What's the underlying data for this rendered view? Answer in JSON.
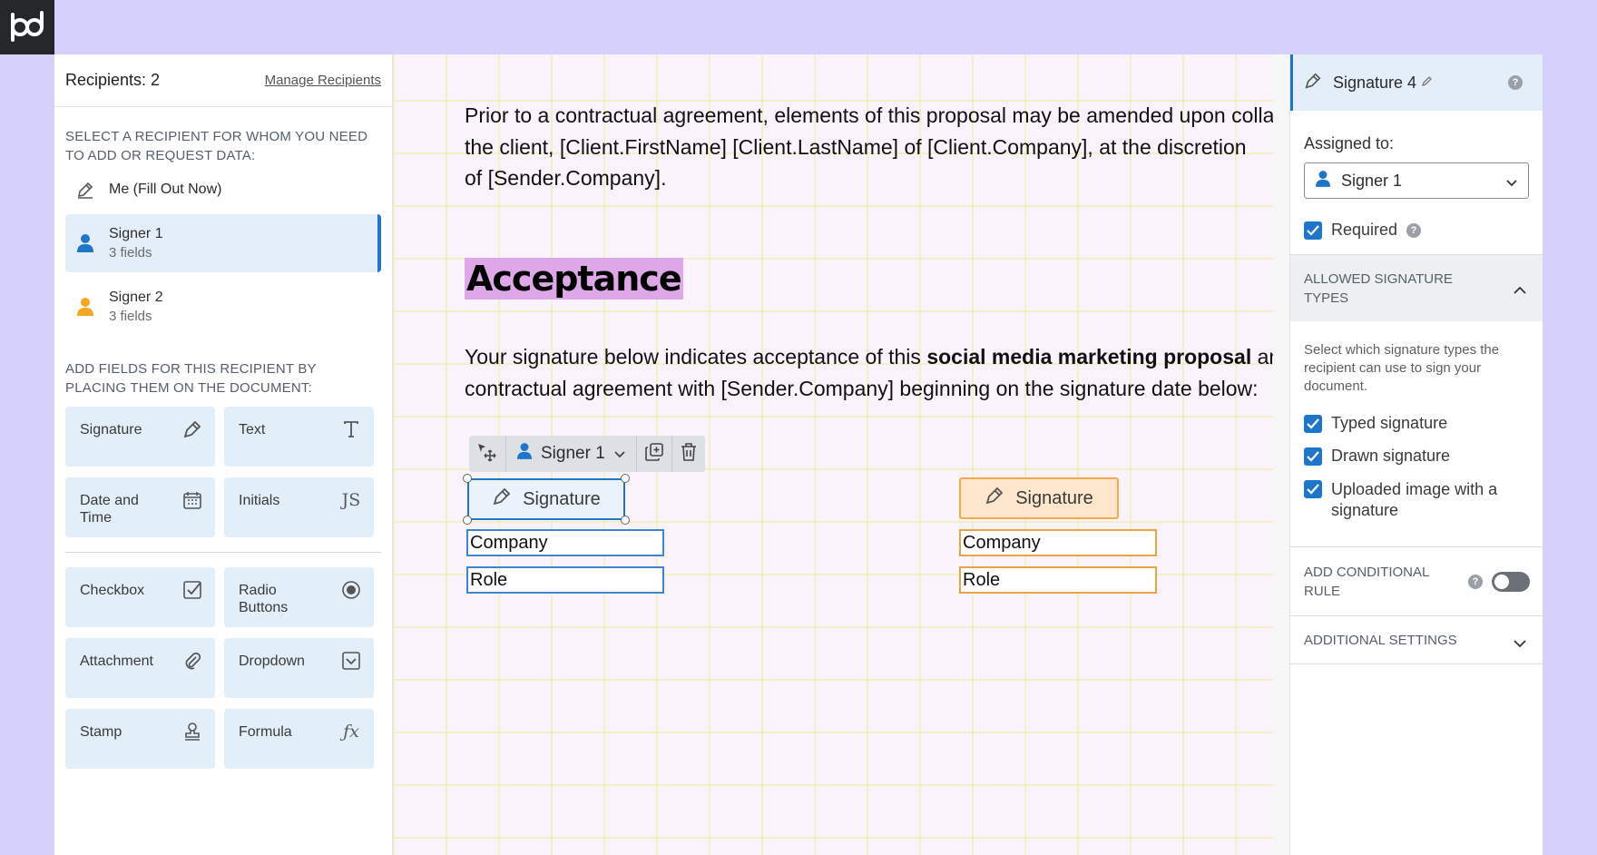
{
  "brand": {
    "logo_icon": "pandadoc-logo-icon"
  },
  "left_panel": {
    "recipients_count_label": "Recipients: 2",
    "manage_link": "Manage Recipients",
    "select_recipient_title": "SELECT A RECIPIENT FOR WHOM YOU NEED TO ADD OR REQUEST DATA:",
    "recipients": [
      {
        "name": "Me (Fill Out Now)",
        "sub": "",
        "icon": "pen-icon"
      },
      {
        "name": "Signer 1",
        "sub": "3 fields",
        "icon": "user-icon",
        "color": "#1f75c9"
      },
      {
        "name": "Signer 2",
        "sub": "3 fields",
        "icon": "user-icon",
        "color": "#f5a623"
      }
    ],
    "add_fields_title": "ADD FIELDS FOR THIS RECIPIENT BY PLACING THEM ON THE DOCUMENT:",
    "fields_primary": [
      {
        "label": "Signature",
        "icon": "signature-icon"
      },
      {
        "label": "Text",
        "icon": "text-icon"
      },
      {
        "label": "Date and Time",
        "icon": "calendar-icon"
      },
      {
        "label": "Initials",
        "icon": "initials-icon"
      }
    ],
    "fields_secondary": [
      {
        "label": "Checkbox",
        "icon": "checkbox-icon"
      },
      {
        "label": "Radio Buttons",
        "icon": "radio-icon"
      },
      {
        "label": "Attachment",
        "icon": "paperclip-icon"
      },
      {
        "label": "Dropdown",
        "icon": "dropdown-icon"
      },
      {
        "label": "Stamp",
        "icon": "stamp-icon"
      },
      {
        "label": "Formula",
        "icon": "formula-icon"
      }
    ]
  },
  "document": {
    "para1_line1": "Prior to a contractual agreement, elements of this proposal may be amended upon colla",
    "para1_line2": "the client, [Client.FirstName] [Client.LastName] of [Client.Company], at the discretion",
    "para1_line3": "of [Sender.Company].",
    "heading": "Acceptance",
    "para2_line1_a": "Your signature below indicates acceptance of this ",
    "para2_line1_bold": "social media marketing proposal",
    "para2_line1_b": " anc",
    "para2_line2": "contractual agreement with [Sender.Company] beginning on the signature date below:",
    "toolbar": {
      "signer_label": "Signer 1"
    },
    "signer1_fields": {
      "signature": "Signature",
      "company": "Company",
      "role": "Role"
    },
    "signer2_fields": {
      "signature": "Signature",
      "company": "Company",
      "role": "Role"
    }
  },
  "properties": {
    "title": "Signature 4",
    "assigned_label": "Assigned to:",
    "assigned_value": "Signer 1",
    "required_label": "Required",
    "allowed_types_title": "ALLOWED SIGNATURE TYPES",
    "allowed_types_desc": "Select which signature types the recipient can use to sign your document.",
    "types": [
      {
        "label": "Typed signature",
        "checked": true
      },
      {
        "label": "Drawn signature",
        "checked": true
      },
      {
        "label": "Uploaded image with a signature",
        "checked": true
      }
    ],
    "conditional_title": "ADD CONDITIONAL RULE",
    "additional_title": "ADDITIONAL SETTINGS"
  },
  "colors": {
    "accent_blue": "#1f75c9",
    "signer2_orange": "#f5a623",
    "background": "#d6d0fc"
  }
}
